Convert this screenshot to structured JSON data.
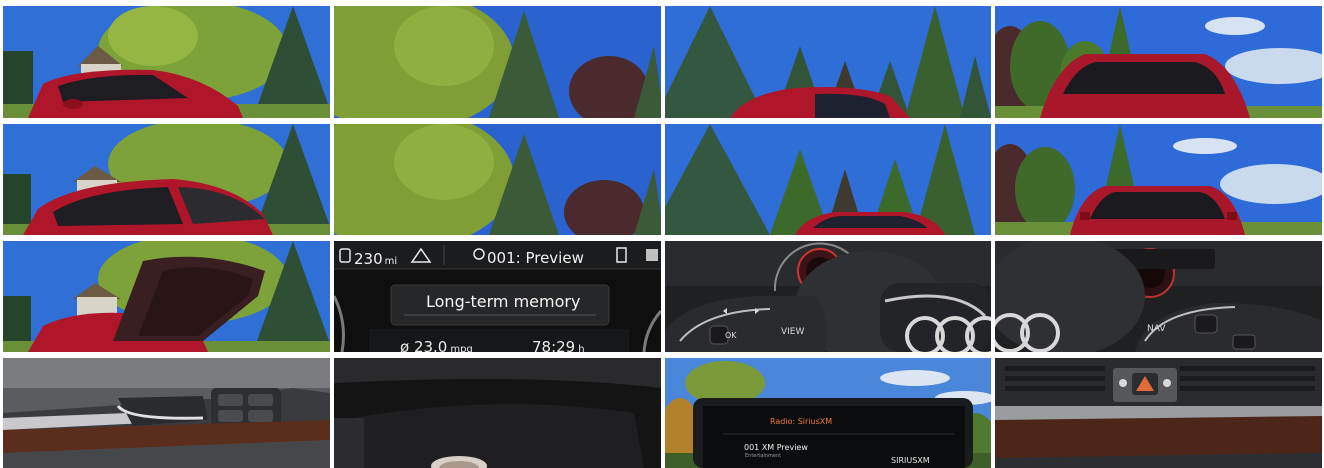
{
  "dashboard": {
    "range_value": "230",
    "range_unit": "mi",
    "station": "001: Preview",
    "panel_title": "Long-term memory",
    "mpg_value": "ø 23.0",
    "mpg_unit": "mpg",
    "trip_time_value": "78:29",
    "trip_time_unit": "h"
  },
  "steering": {
    "view_label": "VIEW",
    "ok_label": "OK",
    "nav_label": "NAV"
  },
  "infotainment": {
    "title": "Radio: SiriusXM",
    "item": "001  XM Preview",
    "item_sub": "Entertainment",
    "brand": "SIRIUSXM"
  },
  "colors": {
    "sky": "#2d6ad6",
    "car_red": "#b0162a",
    "foliage_green": "#4e7a24",
    "spruce": "#2f4f36",
    "dash_black": "#141414"
  }
}
